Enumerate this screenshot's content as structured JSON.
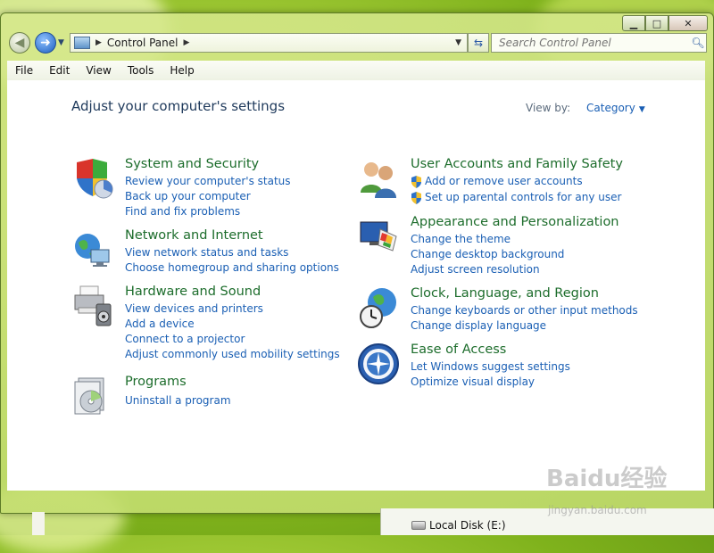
{
  "window": {
    "controls": {
      "minimize": "▁",
      "maximize": "□",
      "close": "✕"
    }
  },
  "nav": {
    "breadcrumb": "Control Panel",
    "search_placeholder": "Search Control Panel"
  },
  "menu": [
    "File",
    "Edit",
    "View",
    "Tools",
    "Help"
  ],
  "content": {
    "heading": "Adjust your computer's settings",
    "view_by_label": "View by:",
    "view_by_value": "Category"
  },
  "categories": [
    {
      "title": "System and Security",
      "icon": "security-shield-icon",
      "links": [
        "Review your computer's status",
        "Back up your computer",
        "Find and fix problems"
      ]
    },
    {
      "title": "Network and Internet",
      "icon": "network-globe-icon",
      "links": [
        "View network status and tasks",
        "Choose homegroup and sharing options"
      ]
    },
    {
      "title": "Hardware and Sound",
      "icon": "printer-speaker-icon",
      "links": [
        "View devices and printers",
        "Add a device",
        "Connect to a projector",
        "Adjust commonly used mobility settings"
      ]
    },
    {
      "title": "Programs",
      "icon": "programs-disc-icon",
      "links": [
        "Uninstall a program"
      ]
    },
    {
      "title": "User Accounts and Family Safety",
      "icon": "users-icon",
      "links": [
        "Add or remove user accounts",
        "Set up parental controls for any user"
      ]
    },
    {
      "title": "Appearance and Personalization",
      "icon": "monitor-paint-icon",
      "links": [
        "Change the theme",
        "Change desktop background",
        "Adjust screen resolution"
      ]
    },
    {
      "title": "Clock, Language, and Region",
      "icon": "clock-globe-icon",
      "links": [
        "Change keyboards or other input methods",
        "Change display language"
      ]
    },
    {
      "title": "Ease of Access",
      "icon": "ease-of-access-icon",
      "links": [
        "Let Windows suggest settings",
        "Optimize visual display"
      ]
    }
  ],
  "taskbar": {
    "drive_label": "Local Disk (E:)"
  },
  "watermark": {
    "brand": "Baidu经验",
    "url": "jingyan.baidu.com"
  }
}
